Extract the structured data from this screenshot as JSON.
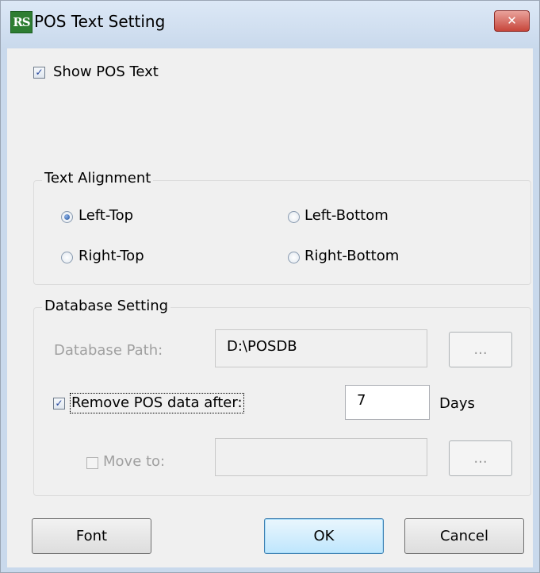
{
  "window": {
    "title": "POS Text Setting",
    "app_icon_text": "RS",
    "close_glyph": "✕"
  },
  "show_pos_text": {
    "label": "Show POS Text",
    "checked": true,
    "mark": "✓"
  },
  "text_alignment": {
    "title": "Text Alignment",
    "options": [
      {
        "label": "Left-Top",
        "selected": true
      },
      {
        "label": "Left-Bottom",
        "selected": false
      },
      {
        "label": "Right-Top",
        "selected": false
      },
      {
        "label": "Right-Bottom",
        "selected": false
      }
    ]
  },
  "database_setting": {
    "title": "Database Setting",
    "path_label": "Database Path:",
    "path_value": "D:\\POSDB",
    "browse_label": "...",
    "remove_label": "Remove POS data after:",
    "remove_checked": true,
    "remove_mark": "✓",
    "days_value": "7",
    "days_label": "Days",
    "move_label": "Move to:",
    "move_checked": false,
    "move_value": "",
    "move_browse_label": "..."
  },
  "buttons": {
    "font": "Font",
    "ok": "OK",
    "cancel": "Cancel"
  },
  "colors": {
    "title_bar": "#c9d9ec",
    "close_button": "#c7463b",
    "checkbox_mark": "#21429c"
  }
}
